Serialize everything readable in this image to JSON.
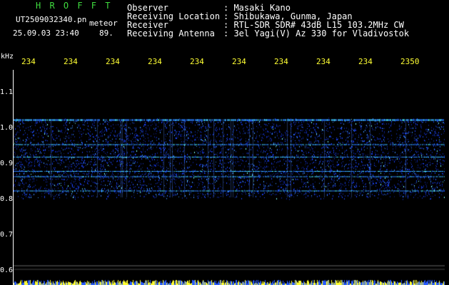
{
  "header": {
    "title": "H R O F F T",
    "filename": "UT2509032340.pn",
    "suffix": "meteor",
    "datetime": "25.09.03 23:40",
    "number": "89."
  },
  "info": [
    {
      "label": "Observer",
      "value": ": Masaki Kano"
    },
    {
      "label": "Receiving Location",
      "value": ": Shibukawa, Gunma, Japan"
    },
    {
      "label": "Receiver",
      "value": ": RTL-SDR SDR# 43dB L15 103.2MHz CW"
    },
    {
      "label": "Receiving Antenna",
      "value": ": 3el Yagi(V) Az 330 for Vladivostok"
    }
  ],
  "axis": {
    "y_unit": "kHz",
    "x_ticks": [
      "234",
      "234",
      "234",
      "234",
      "234",
      "234",
      "234",
      "234",
      "234",
      "2350"
    ],
    "y_ticks": [
      "1.1",
      "1.0",
      "0.9",
      "0.8",
      "0.7",
      "0.6"
    ]
  },
  "colors": {
    "background": "#000000",
    "text_green": "#3fdc3f",
    "tick_yellow": "#ffff33",
    "signal_blue": "#1e46ff",
    "signal_cyan": "#50ffff"
  },
  "chart_data": {
    "type": "heatmap",
    "y_unit": "kHz",
    "ylim": [
      0.6,
      1.12
    ],
    "noise_band_khz": [
      0.8,
      1.03
    ],
    "horizontal_lines_khz": [
      1.025,
      0.955,
      0.92,
      0.88,
      0.865,
      0.825
    ],
    "meteor_count": 89
  }
}
